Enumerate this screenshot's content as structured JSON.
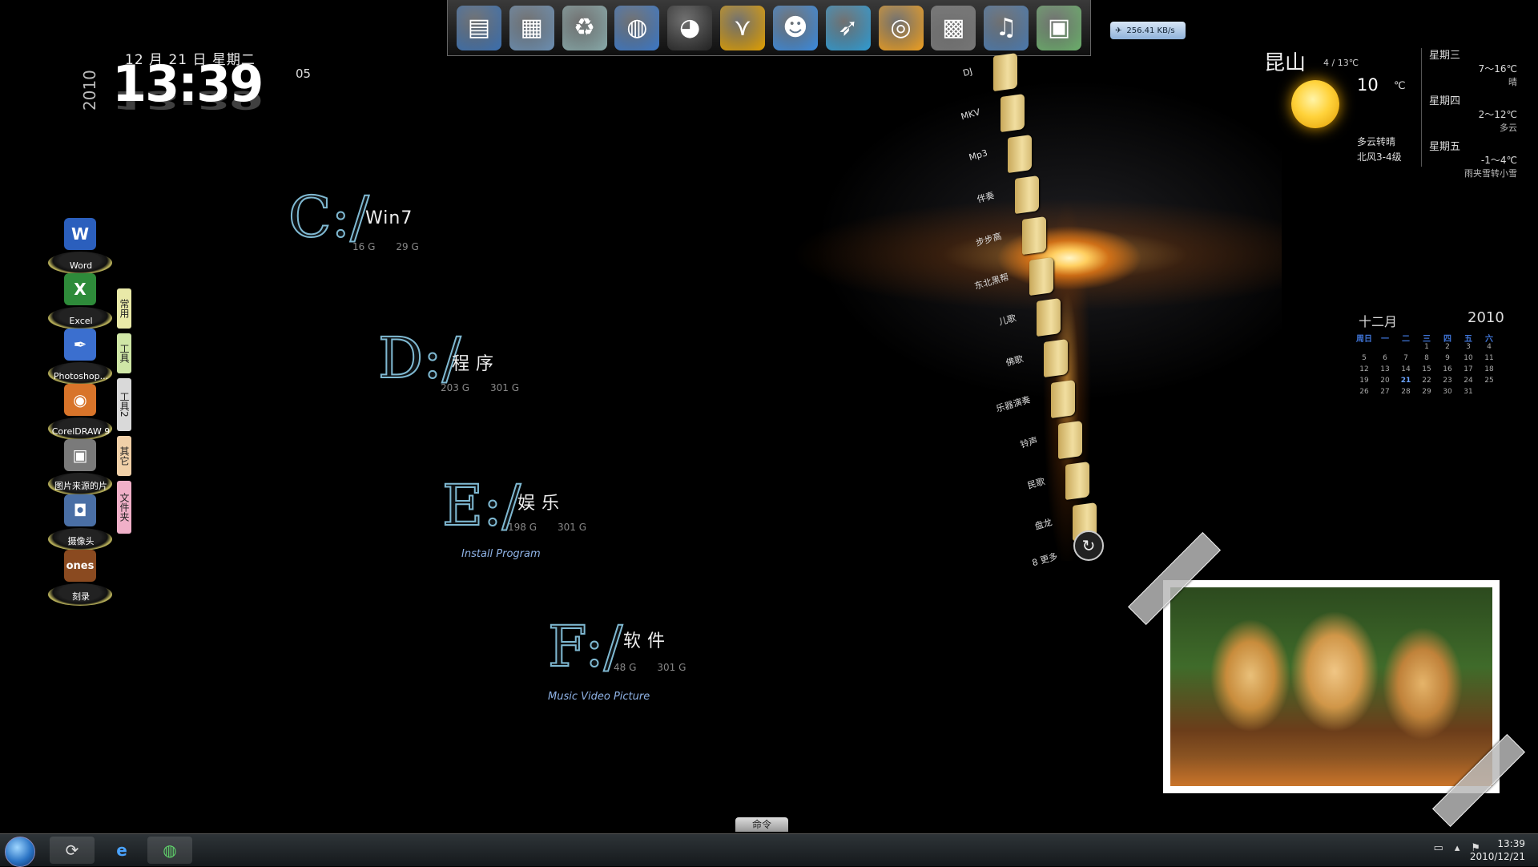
{
  "clock": {
    "date": "12 月 21 日 星期二",
    "year": "2010",
    "time": "13:39",
    "seconds": "05"
  },
  "dock": {
    "icons": [
      "desktop-monitor-icon",
      "computer-icon",
      "recycle-bin-icon",
      "globe-icon",
      "qq-penguin-icon",
      "bat-icon",
      "smiley-icon",
      "bird-icon",
      "music-player-icon",
      "control-panel-icon",
      "media-icon",
      "picture-icon"
    ],
    "net_speed": "256.41 KB/s"
  },
  "drives": [
    {
      "letter": "C:/",
      "name": "Win7",
      "used": "16 G",
      "total": "29 G",
      "sub": ""
    },
    {
      "letter": "D:/",
      "name": "程序",
      "used": "203 G",
      "total": "301 G",
      "sub": ""
    },
    {
      "letter": "E:/",
      "name": "娱乐",
      "used": "198 G",
      "total": "301 G",
      "sub": "Install Program"
    },
    {
      "letter": "F:/",
      "name": "软件",
      "used": "48 G",
      "total": "301 G",
      "sub": "Music Video Picture"
    }
  ],
  "shelf": {
    "items": [
      {
        "label": "Word",
        "icon": "W",
        "color": "#2b5fbd"
      },
      {
        "label": "Excel",
        "icon": "X",
        "color": "#2e8b3a"
      },
      {
        "label": "Photoshop...",
        "icon": "✒",
        "color": "#3b6fcf"
      },
      {
        "label": "CorelDRAW 9",
        "icon": "◉",
        "color": "#d8742a"
      },
      {
        "label": "图片来源的片",
        "icon": "▣",
        "color": "#7a7a7a"
      },
      {
        "label": "摄像头",
        "icon": "◘",
        "color": "#4a6fa5"
      },
      {
        "label": "刻录",
        "icon": "ones",
        "color": "#8a4a20"
      }
    ],
    "tabs": [
      {
        "label": "常用",
        "color": "#e9e9a8"
      },
      {
        "label": "工具",
        "color": "#cfe6a6"
      },
      {
        "label": "工具2",
        "color": "#d9d9d9"
      },
      {
        "label": "其它",
        "color": "#f0d0a8"
      },
      {
        "label": "文件夹",
        "color": "#f0b0c8"
      }
    ]
  },
  "folders": {
    "items": [
      "DJ",
      "MKV",
      "Mp3",
      "伴奏",
      "步步高",
      "东北黑帮",
      "儿歌",
      "佛歌",
      "乐器演奏",
      "铃声",
      "民歌",
      "盘龙"
    ],
    "more": "8 更多"
  },
  "weather": {
    "city": "昆山",
    "range": "4 / 13℃",
    "temp": "10",
    "unit": "℃",
    "desc1": "多云转晴",
    "desc2": "北风3-4级",
    "forecast": [
      {
        "day": "星期三",
        "temp": "7～16℃",
        "cond": "晴"
      },
      {
        "day": "星期四",
        "temp": "2～12℃",
        "cond": "多云"
      },
      {
        "day": "星期五",
        "temp": "-1～4℃",
        "cond": "雨夹雪转小雪"
      }
    ]
  },
  "calendar": {
    "month": "十二月",
    "year": "2010",
    "headers": [
      "周日",
      "一",
      "二",
      "三",
      "四",
      "五",
      "六"
    ],
    "weeks": [
      [
        "",
        "",
        "",
        "1",
        "2",
        "3",
        "4"
      ],
      [
        "5",
        "6",
        "7",
        "8",
        "9",
        "10",
        "11"
      ],
      [
        "12",
        "13",
        "14",
        "15",
        "16",
        "17",
        "18"
      ],
      [
        "19",
        "20",
        "21",
        "22",
        "23",
        "24",
        "25"
      ],
      [
        "26",
        "27",
        "28",
        "29",
        "30",
        "31",
        ""
      ]
    ],
    "today": "21"
  },
  "command_tab": "命令",
  "taskbar": {
    "time": "13:39",
    "date": "2010/12/21"
  }
}
